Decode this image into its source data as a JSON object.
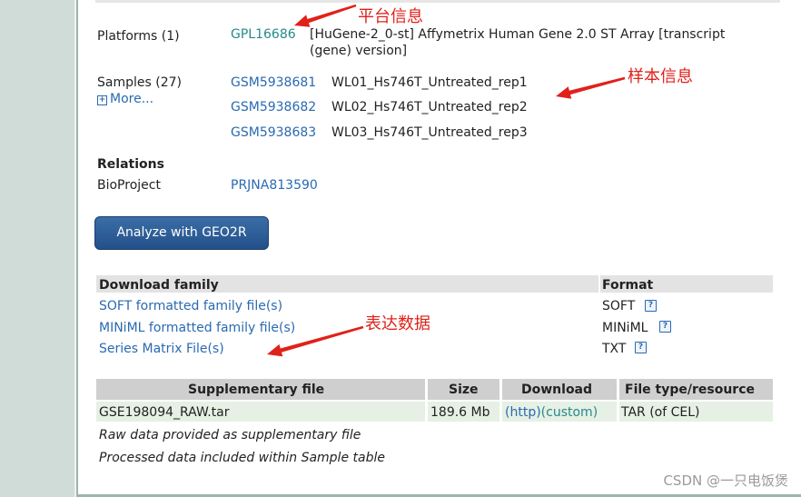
{
  "platforms": {
    "label": "Platforms (1)",
    "accession": "GPL16686",
    "description_line1": "[HuGene-2_0-st] Affymetrix Human Gene 2.0 ST Array [transcript",
    "description_line2": "(gene) version]"
  },
  "samples": {
    "label": "Samples (27)",
    "more_label": "More...",
    "more_icon": "+",
    "items": [
      {
        "accession": "GSM5938681",
        "title": "WL01_Hs746T_Untreated_rep1"
      },
      {
        "accession": "GSM5938682",
        "title": "WL02_Hs746T_Untreated_rep2"
      },
      {
        "accession": "GSM5938683",
        "title": "WL03_Hs746T_Untreated_rep3"
      }
    ]
  },
  "relations": {
    "heading": "Relations",
    "bioproject_label": "BioProject",
    "bioproject_value": "PRJNA813590"
  },
  "geo2r_button": "Analyze with GEO2R",
  "download_family": {
    "header": "Download family",
    "format_header": "Format",
    "help_icon": "?",
    "rows": [
      {
        "label": "SOFT formatted family file(s)",
        "format": "SOFT"
      },
      {
        "label": "MINiML formatted family file(s)",
        "format": "MINiML"
      },
      {
        "label": "Series Matrix File(s)",
        "format": "TXT"
      }
    ]
  },
  "supplementary": {
    "headers": [
      "Supplementary file",
      "Size",
      "Download",
      "File type/resource"
    ],
    "row": {
      "file": "GSE198094_RAW.tar",
      "size": "189.6 Mb",
      "download_http": "(http)",
      "download_custom": "(custom)",
      "type": "TAR (of CEL)"
    },
    "note1": "Raw data provided as supplementary file",
    "note2": "Processed data included within Sample table"
  },
  "annotations": {
    "platform": "平台信息",
    "samples": "样本信息",
    "expression": "表达数据",
    "color": "#e0211a"
  },
  "watermark": "CSDN @一只电饭煲"
}
